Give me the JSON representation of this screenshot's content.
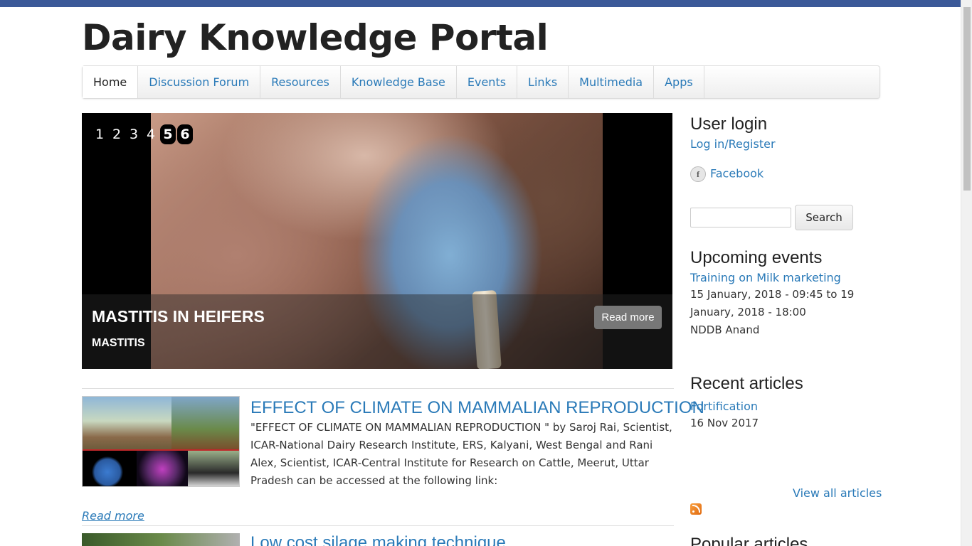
{
  "site": {
    "title": "Dairy Knowledge Portal"
  },
  "nav": {
    "items": [
      {
        "label": "Home",
        "active": true
      },
      {
        "label": "Discussion Forum"
      },
      {
        "label": "Resources"
      },
      {
        "label": "Knowledge Base"
      },
      {
        "label": "Events"
      },
      {
        "label": "Links"
      },
      {
        "label": "Multimedia"
      },
      {
        "label": "Apps"
      }
    ]
  },
  "slider": {
    "pages": [
      "1",
      "2",
      "3",
      "4",
      "5",
      "6"
    ],
    "current_page": "5",
    "title": "MASTITIS IN HEIFERS",
    "subtitle": "MASTITIS",
    "read_more": "Read more"
  },
  "articles": [
    {
      "title": "EFFECT OF CLIMATE ON MAMMALIAN REPRODUCTION",
      "body": "\"EFFECT OF CLIMATE ON MAMMALIAN REPRODUCTION \" by  Saroj Rai, Scientist, ICAR-National Dairy Research Institute, ERS, Kalyani, West Bengal and Rani Alex, Scientist, ICAR-Central Institute for Research on Cattle, Meerut, Uttar Pradesh can be accessed at the following link:",
      "read_more": "Read more"
    },
    {
      "title": "Low cost silage making technique"
    }
  ],
  "sidebar": {
    "user_login": {
      "heading": "User login",
      "link": "Log in/Register",
      "facebook": "Facebook"
    },
    "search": {
      "button": "Search",
      "value": ""
    },
    "events": {
      "heading": "Upcoming events",
      "title": "Training on Milk marketing",
      "date": "15 January, 2018 - 09:45 to 19 January, 2018 - 18:00",
      "location": "NDDB Anand"
    },
    "recent": {
      "heading": "Recent articles",
      "title": "Fortification",
      "date": "16 Nov 2017",
      "view_all": "View all articles"
    },
    "popular": {
      "heading": "Popular articles"
    }
  },
  "colors": {
    "link": "#2a7ab8",
    "topbar": "#3b5998"
  }
}
